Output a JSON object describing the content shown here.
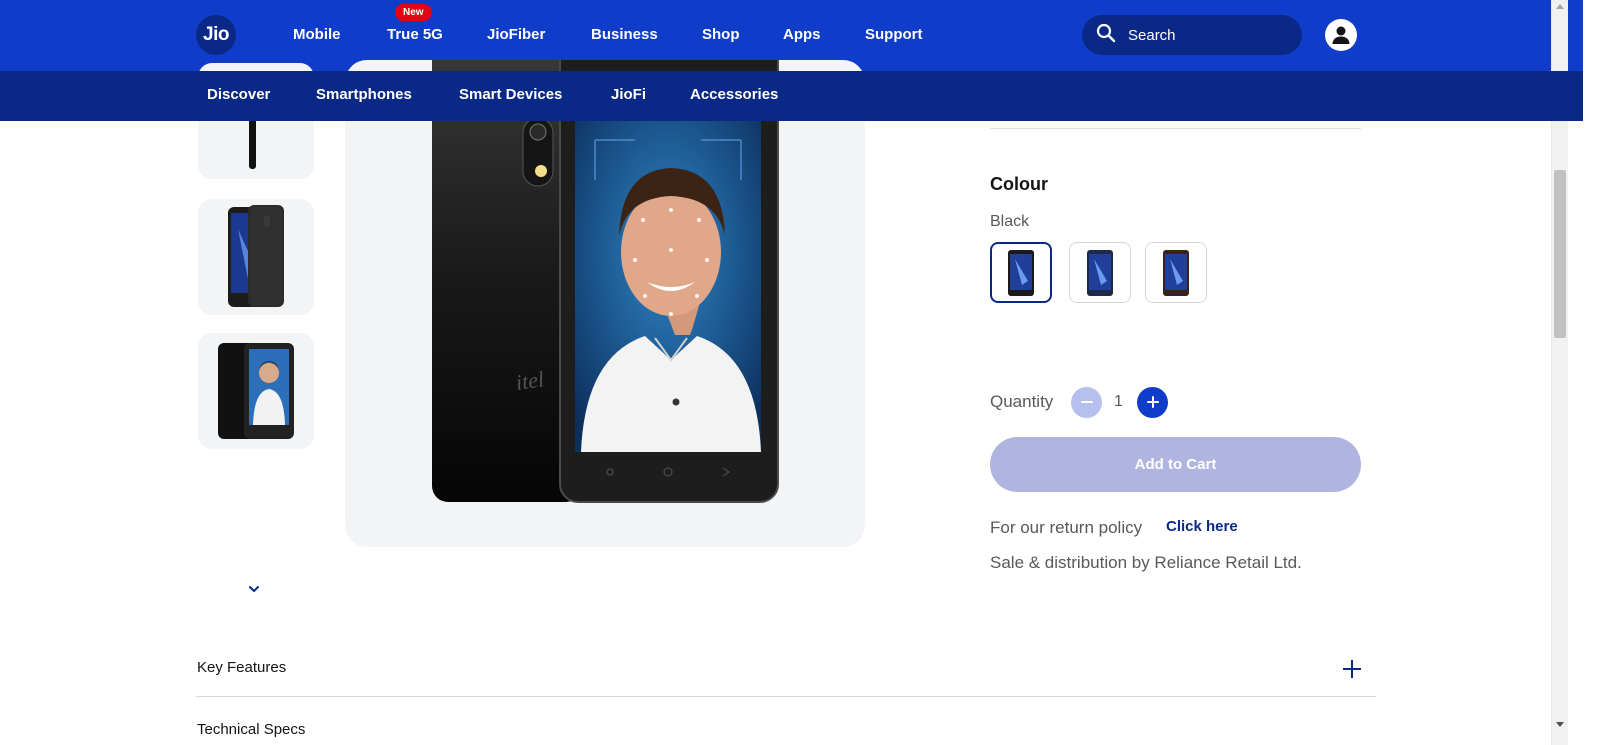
{
  "header": {
    "logo_text": "Jio",
    "nav": [
      {
        "label": "Mobile"
      },
      {
        "label": "True 5G",
        "badge": "New"
      },
      {
        "label": "JioFiber"
      },
      {
        "label": "Business"
      },
      {
        "label": "Shop"
      },
      {
        "label": "Apps"
      },
      {
        "label": "Support"
      }
    ],
    "search_placeholder": "Search",
    "search_icon": "search-icon",
    "user_icon": "user-account-icon"
  },
  "subnav": {
    "items": [
      {
        "label": "Discover"
      },
      {
        "label": "Smartphones"
      },
      {
        "label": "Smart Devices"
      },
      {
        "label": "JioFi"
      },
      {
        "label": "Accessories"
      }
    ]
  },
  "gallery": {
    "thumbnails": [
      "phone-side-view",
      "phone-back-view",
      "phone-front-face-view"
    ],
    "scroll_icon": "chevron-down-icon"
  },
  "product": {
    "colour_title": "Colour",
    "selected_colour": "Black",
    "colour_swatches": [
      "Black",
      "Blue",
      "Brown"
    ],
    "quantity_label": "Quantity",
    "quantity_value": "1",
    "add_to_cart_label": "Add to Cart",
    "return_policy_text": "For our return policy",
    "return_policy_link": "Click here",
    "sale_text": "Sale & distribution by Reliance Retail Ltd."
  },
  "accordion": {
    "items": [
      {
        "label": "Key Features"
      },
      {
        "label": "Technical Specs"
      }
    ],
    "expand_icon": "plus-icon"
  },
  "colors": {
    "brand_blue": "#0f3cc9",
    "brand_navy": "#0a2885",
    "badge_red": "#e30513",
    "cart_disabled": "#b0b5e0"
  }
}
